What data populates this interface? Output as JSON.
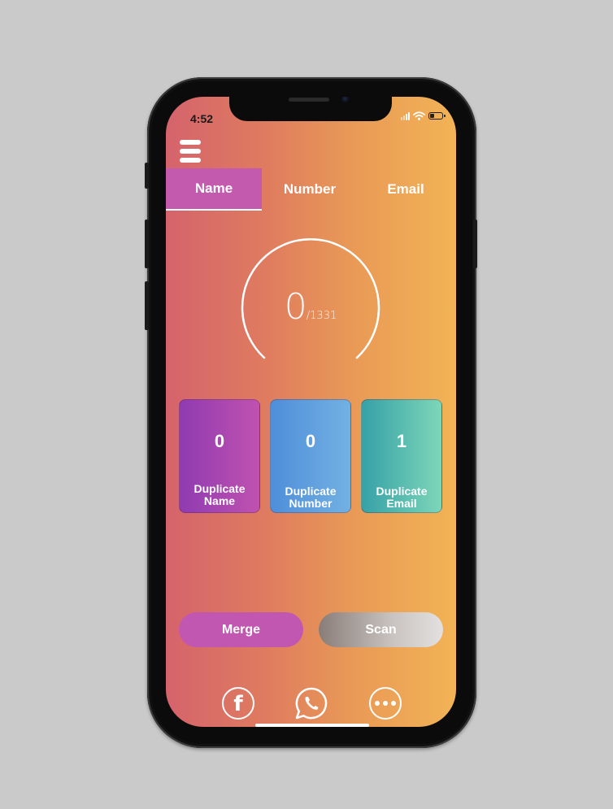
{
  "status_bar": {
    "time": "4:52"
  },
  "tabs": [
    {
      "label": "Name",
      "active": true
    },
    {
      "label": "Number",
      "active": false
    },
    {
      "label": "Email",
      "active": false
    }
  ],
  "gauge": {
    "count": "0",
    "total": "/1331"
  },
  "cards": {
    "name": {
      "count": "0",
      "label_line1": "Duplicate",
      "label_line2": "Name"
    },
    "number": {
      "count": "0",
      "label_line1": "Duplicate",
      "label_line2": "Number"
    },
    "email": {
      "count": "1",
      "label_line1": "Duplicate",
      "label_line2": "Email"
    }
  },
  "buttons": {
    "merge": "Merge",
    "scan": "Scan"
  },
  "share_icons": [
    "facebook-icon",
    "whatsapp-icon",
    "more-icon"
  ],
  "colors": {
    "background_start": "#d5636c",
    "background_end": "#f2b355",
    "tab_active": "#c45aae",
    "merge_button": "#c257b2"
  }
}
